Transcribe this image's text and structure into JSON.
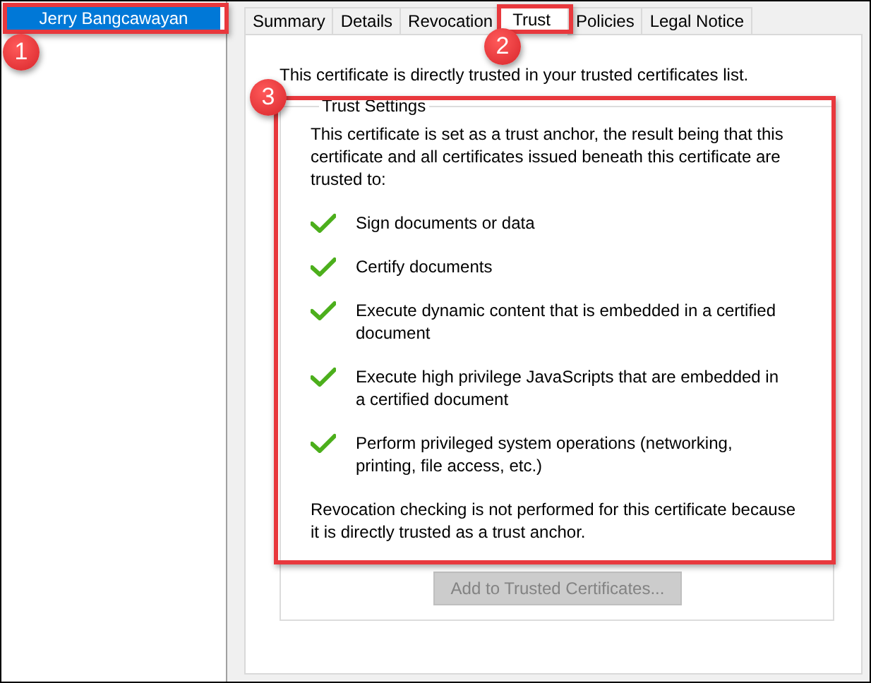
{
  "sidebar": {
    "items": [
      {
        "label": "Jerry Bangcawayan",
        "selected": true
      }
    ]
  },
  "tabs": [
    {
      "label": "Summary",
      "selected": false
    },
    {
      "label": "Details",
      "selected": false
    },
    {
      "label": "Revocation",
      "selected": false
    },
    {
      "label": "Trust",
      "selected": true
    },
    {
      "label": "Policies",
      "selected": false
    },
    {
      "label": "Legal Notice",
      "selected": false
    }
  ],
  "trust_status": "This certificate is directly trusted in your trusted certificates list.",
  "trust_settings": {
    "title": "Trust Settings",
    "intro": "This certificate is set as a trust anchor, the result being that this certificate and all certificates issued beneath this certificate are trusted to:",
    "items": [
      {
        "label": "Sign documents or data",
        "checked": true
      },
      {
        "label": "Certify documents",
        "checked": true
      },
      {
        "label": "Execute dynamic content that is embedded in a certified document",
        "checked": true
      },
      {
        "label": "Execute high privilege JavaScripts that are embedded in a certified document",
        "checked": true
      },
      {
        "label": "Perform privileged system operations (networking, printing, file access, etc.)",
        "checked": true
      }
    ],
    "note": "Revocation checking is not performed for this certificate because it is directly trusted as a trust anchor."
  },
  "button": {
    "label": "Add to Trusted Certificates...",
    "disabled": true
  },
  "callouts": [
    {
      "number": "1"
    },
    {
      "number": "2"
    },
    {
      "number": "3"
    }
  ]
}
